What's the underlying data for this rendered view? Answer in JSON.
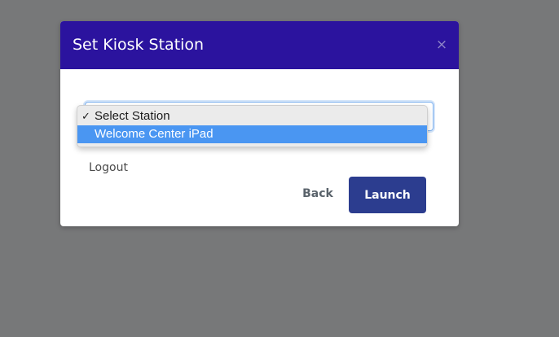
{
  "modal": {
    "title": "Set Kiosk Station",
    "close_icon": "close-icon",
    "close_label": "×"
  },
  "station_select": {
    "selected": "Select Station",
    "options": [
      {
        "label": "Select Station",
        "checked": true,
        "highlighted": false
      },
      {
        "label": "Welcome Center iPad",
        "checked": false,
        "highlighted": true
      }
    ],
    "check_glyph": "✓"
  },
  "footer": {
    "logout_label": "Logout",
    "back_label": "Back",
    "launch_label": "Launch"
  },
  "colors": {
    "header_bg": "#2b139e",
    "launch_bg": "#2c3d8f",
    "highlight": "#4a96f2",
    "backdrop": "#777879"
  }
}
